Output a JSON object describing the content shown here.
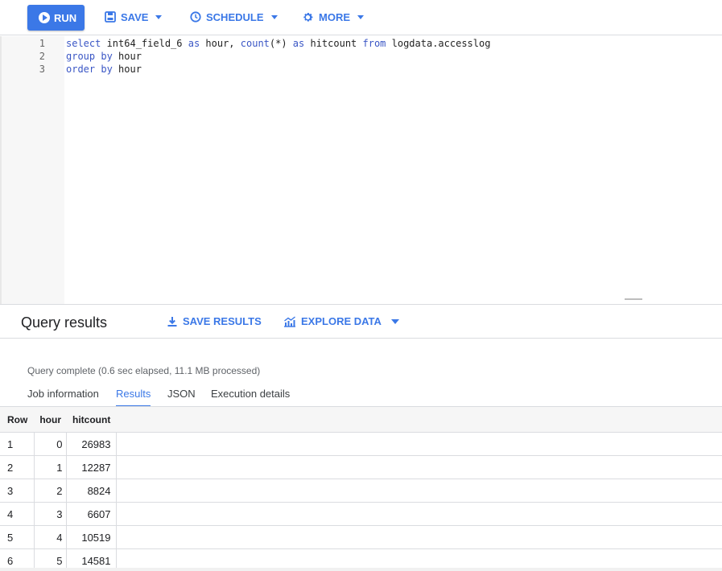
{
  "toolbar": {
    "run_label": "RUN",
    "save_label": "SAVE",
    "schedule_label": "SCHEDULE",
    "more_label": "MORE"
  },
  "editor": {
    "line_numbers": [
      "1",
      "2",
      "3"
    ]
  },
  "results": {
    "title": "Query results",
    "save_results_label": "SAVE RESULTS",
    "explore_data_label": "EXPLORE DATA",
    "status": "Query complete (0.6 sec elapsed, 11.1 MB processed)",
    "tabs": [
      "Job information",
      "Results",
      "JSON",
      "Execution details"
    ],
    "active_tab": "Results",
    "columns": [
      "Row",
      "hour",
      "hitcount"
    ],
    "rows": [
      {
        "row": "1",
        "hour": "0",
        "hitcount": "26983"
      },
      {
        "row": "2",
        "hour": "1",
        "hitcount": "12287"
      },
      {
        "row": "3",
        "hour": "2",
        "hitcount": "8824"
      },
      {
        "row": "4",
        "hour": "3",
        "hitcount": "6607"
      },
      {
        "row": "5",
        "hour": "4",
        "hitcount": "10519"
      },
      {
        "row": "6",
        "hour": "5",
        "hitcount": "14581"
      }
    ]
  },
  "colors": {
    "accent": "#3b78e7",
    "keyword": "#3a56c5"
  },
  "icons": [
    "play-icon",
    "save-icon",
    "clock-icon",
    "gear-icon",
    "download-icon",
    "chart-icon",
    "chevron-down-icon"
  ]
}
